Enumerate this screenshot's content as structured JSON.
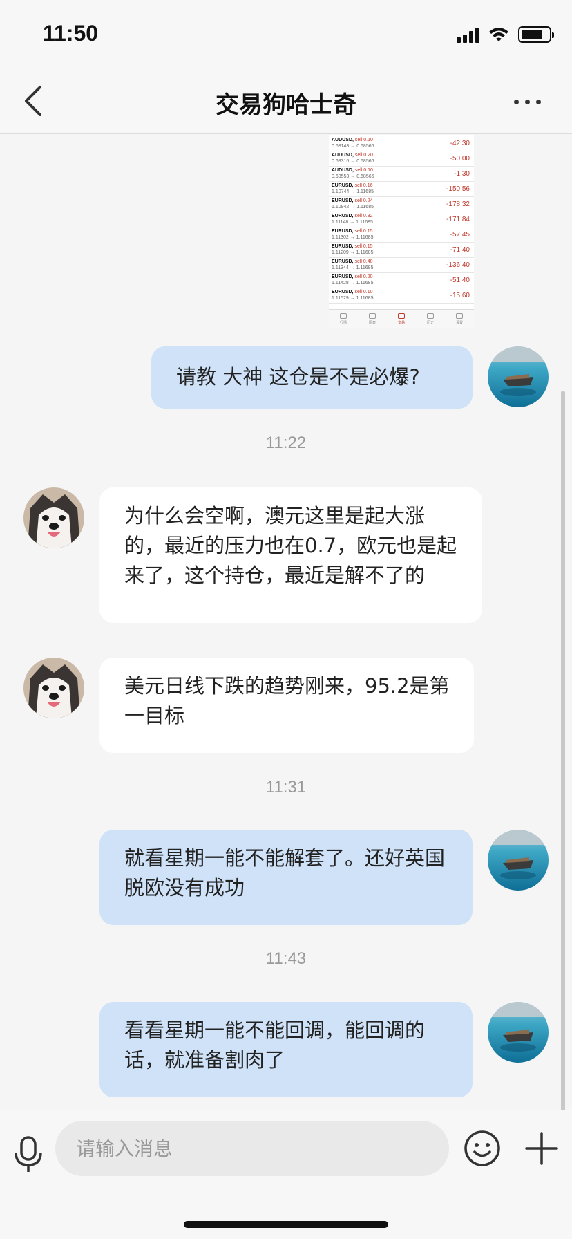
{
  "status_bar": {
    "time": "11:50",
    "battery_level": 0.8
  },
  "nav": {
    "title": "交易狗哈士奇",
    "back_icon": "chevron-left-icon",
    "more_icon": "more-dots-icon"
  },
  "screenshot_message": {
    "rows": [
      {
        "symbol": "AUDUSD,",
        "action": "sell 0.10",
        "prices": "0.68143 → 0.68566",
        "pnl": "-42.30"
      },
      {
        "symbol": "AUDUSD,",
        "action": "sell 0.20",
        "prices": "0.68316 → 0.68566",
        "pnl": "-50.00"
      },
      {
        "symbol": "AUDUSD,",
        "action": "sell 0.10",
        "prices": "0.68553 → 0.68566",
        "pnl": "-1.30"
      },
      {
        "symbol": "EURUSD,",
        "action": "sell 0.16",
        "prices": "1.10744 → 1.11685",
        "pnl": "-150.56"
      },
      {
        "symbol": "EURUSD,",
        "action": "sell 0.24",
        "prices": "1.10942 → 1.11685",
        "pnl": "-178.32"
      },
      {
        "symbol": "EURUSD,",
        "action": "sell 0.32",
        "prices": "1.11148 → 1.11685",
        "pnl": "-171.84"
      },
      {
        "symbol": "EURUSD,",
        "action": "sell 0.15",
        "prices": "1.11302 → 1.11685",
        "pnl": "-57.45"
      },
      {
        "symbol": "EURUSD,",
        "action": "sell 0.15",
        "prices": "1.11209 → 1.11685",
        "pnl": "-71.40"
      },
      {
        "symbol": "EURUSD,",
        "action": "sell 0.40",
        "prices": "1.11344 → 1.11685",
        "pnl": "-136.40"
      },
      {
        "symbol": "EURUSD,",
        "action": "sell 0.20",
        "prices": "1.11428 → 1.11685",
        "pnl": "-51.40"
      },
      {
        "symbol": "EURUSD,",
        "action": "sell 0.10",
        "prices": "1.11529 → 1.11685",
        "pnl": "-15.60"
      }
    ],
    "tabs": [
      "行情",
      "图表",
      "交易",
      "历史",
      "设置"
    ]
  },
  "messages": {
    "m1": {
      "text": "请教 大神 这仓是不是必爆?"
    },
    "t1": "11:22",
    "m2": {
      "text": "为什么会空啊，澳元这里是起大涨的，最近的压力也在0.7，欧元也是起来了，这个持仓，最近是解不了的"
    },
    "m3": {
      "text": "美元日线下跌的趋势刚来，95.2是第一目标"
    },
    "t2": "11:31",
    "m4": {
      "text": "就看星期一能不能解套了。还好英国脱欧没有成功"
    },
    "t3": "11:43",
    "m5": {
      "text": "看看星期一能不能回调，能回调的话，就准备割肉了"
    }
  },
  "input_bar": {
    "placeholder": "请输入消息",
    "mic_icon": "microphone-icon",
    "emoji_icon": "emoji-icon",
    "plus_icon": "plus-icon"
  },
  "colors": {
    "sent_bubble": "#cfe2f8",
    "recv_bubble": "#ffffff",
    "loss": "#c0392b"
  }
}
